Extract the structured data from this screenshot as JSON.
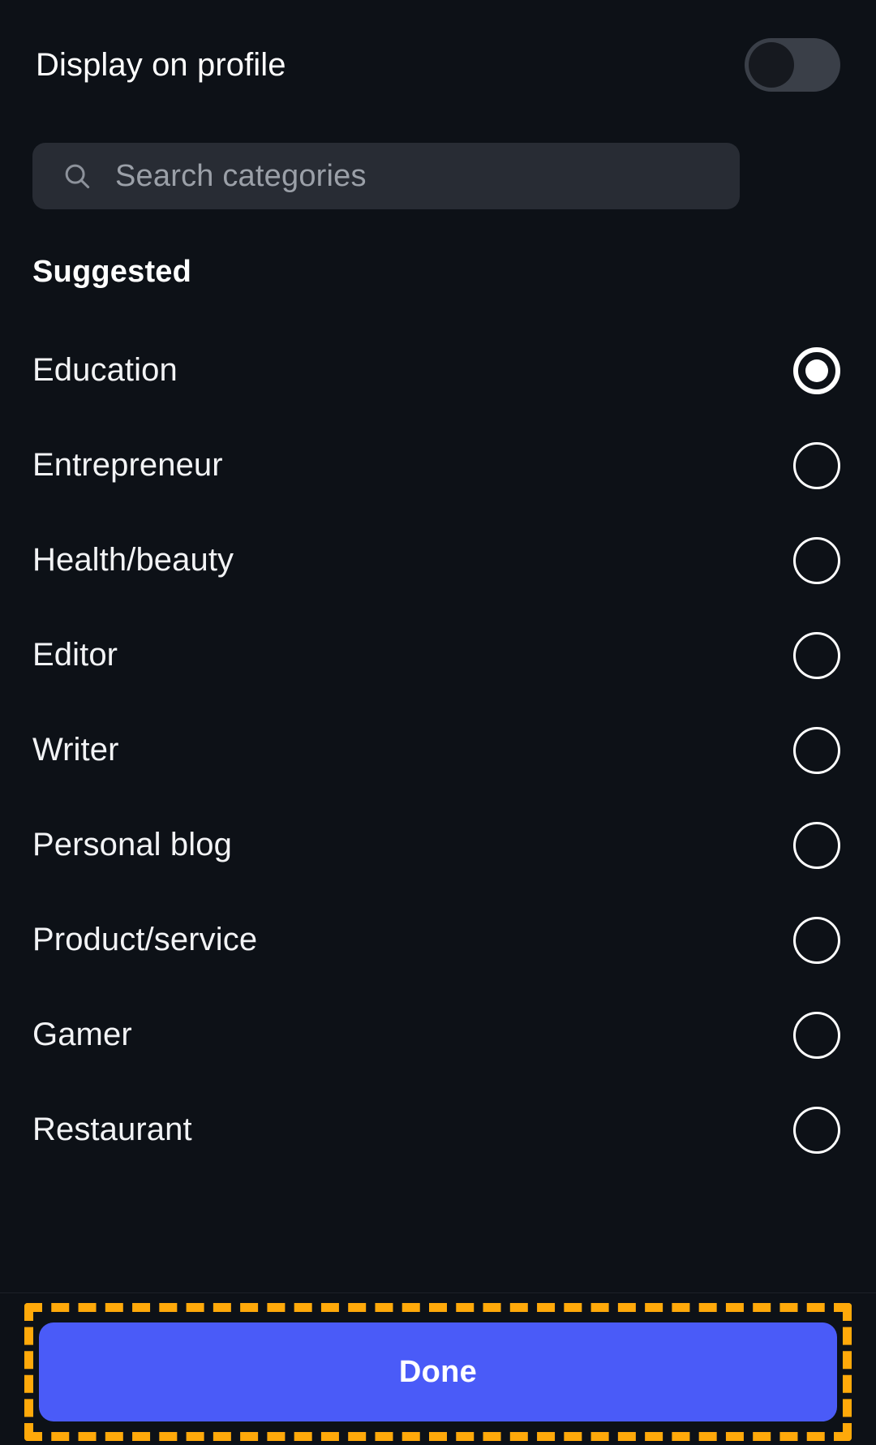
{
  "colors": {
    "background": "#0d1117",
    "search_field": "#282c34",
    "toggle_track_off": "#3a3f48",
    "toggle_knob": "#16191f",
    "accent_button": "#4a5bf8",
    "highlight_dash": "#ffa90a",
    "text_primary": "#ffffff",
    "text_placeholder": "#9ba0a8"
  },
  "display_toggle": {
    "label": "Display on profile",
    "state": "off"
  },
  "search": {
    "icon": "search-icon",
    "placeholder": "Search categories",
    "value": ""
  },
  "list": {
    "heading": "Suggested",
    "items": [
      {
        "label": "Education",
        "selected": true
      },
      {
        "label": "Entrepreneur",
        "selected": false
      },
      {
        "label": "Health/beauty",
        "selected": false
      },
      {
        "label": "Editor",
        "selected": false
      },
      {
        "label": "Writer",
        "selected": false
      },
      {
        "label": "Personal blog",
        "selected": false
      },
      {
        "label": "Product/service",
        "selected": false
      },
      {
        "label": "Gamer",
        "selected": false
      },
      {
        "label": "Restaurant",
        "selected": false
      }
    ]
  },
  "footer": {
    "done_label": "Done",
    "highlighted": true
  }
}
